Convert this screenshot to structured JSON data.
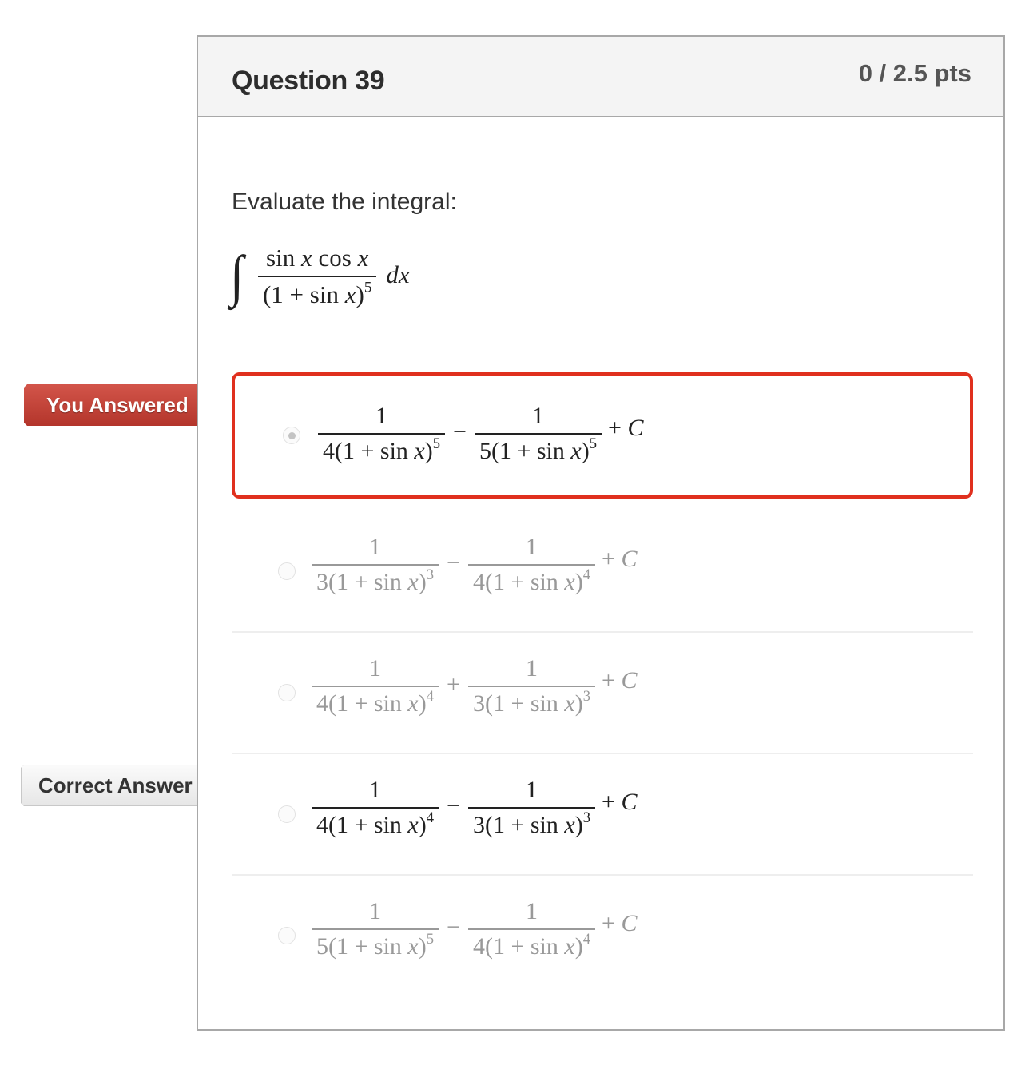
{
  "question": {
    "title": "Question 39",
    "points": "0 / 2.5 pts",
    "prompt": "Evaluate the integral:",
    "integral": {
      "sign": "∫",
      "numerator": "sin x cos x",
      "denominator": "(1 + sin x)⁵",
      "differential": "dx"
    }
  },
  "flags": {
    "you_answered": "You Answered",
    "correct_answer": "Correct Answer"
  },
  "colors": {
    "wrong_accent": "#e0301e",
    "you_answered_flag": "#c0392b",
    "correct_flag": "#f0f0f0"
  },
  "answers": [
    {
      "left": {
        "num": "1",
        "coef": "4",
        "power": "5"
      },
      "op": "−",
      "right": {
        "num": "1",
        "coef": "5",
        "power": "5"
      },
      "tail": "+ C",
      "selected": true,
      "status": "you-answered-wrong"
    },
    {
      "left": {
        "num": "1",
        "coef": "3",
        "power": "3"
      },
      "op": "−",
      "right": {
        "num": "1",
        "coef": "4",
        "power": "4"
      },
      "tail": "+ C",
      "selected": false,
      "status": "unselected"
    },
    {
      "left": {
        "num": "1",
        "coef": "4",
        "power": "4"
      },
      "op": "+",
      "right": {
        "num": "1",
        "coef": "3",
        "power": "3"
      },
      "tail": "+ C",
      "selected": false,
      "status": "unselected"
    },
    {
      "left": {
        "num": "1",
        "coef": "4",
        "power": "4"
      },
      "op": "−",
      "right": {
        "num": "1",
        "coef": "3",
        "power": "3"
      },
      "tail": "+ C",
      "selected": false,
      "status": "correct-answer"
    },
    {
      "left": {
        "num": "1",
        "coef": "5",
        "power": "5"
      },
      "op": "−",
      "right": {
        "num": "1",
        "coef": "4",
        "power": "4"
      },
      "tail": "+ C",
      "selected": false,
      "status": "unselected"
    }
  ],
  "math_fragments": {
    "open": "(1 + ",
    "sin": "sin",
    "x": "x",
    "close": ")"
  }
}
